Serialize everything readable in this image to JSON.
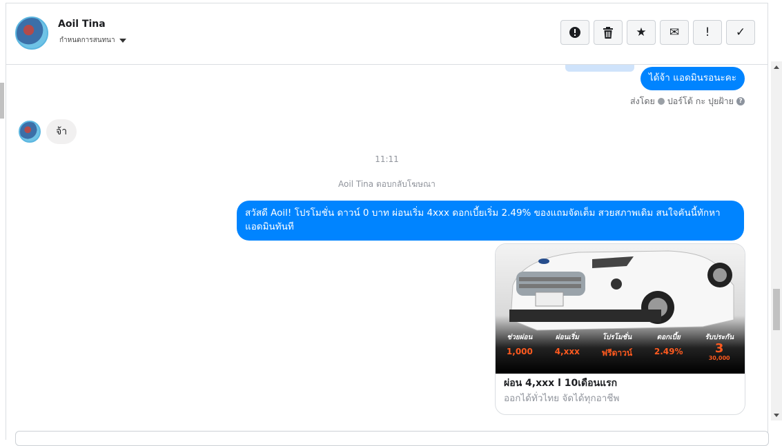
{
  "header": {
    "name": "Aoil Tina",
    "subtitle": "กำหนดการสนทนา"
  },
  "toolbar": {
    "buttons": [
      {
        "icon": "alert-circle-icon",
        "glyph": "!"
      },
      {
        "icon": "trash-icon"
      },
      {
        "icon": "star-icon",
        "glyph": "★"
      },
      {
        "icon": "envelope-icon",
        "glyph": "✉"
      },
      {
        "icon": "exclamation-icon",
        "glyph": "!"
      },
      {
        "icon": "check-icon",
        "glyph": "✓"
      }
    ]
  },
  "messages": {
    "top_reply": "ได้จ้า แอดมินรอนะคะ",
    "sent_by_label": "ส่งโดย",
    "sent_by_name": "ปอร์โต้ กะ ปุยฝ้าย",
    "incoming_text": "จ้า",
    "time": "11:11",
    "ad_reply_note": "Aoil Tina ตอบกลับโฆษณา",
    "promo_text": "สวัสดี Aoil! โปรโมชั่น ดาวน์ 0 บาท ผ่อนเริ่ม 4xxx ดอกเบี้ยเริ่ม 2.49% ของแถมจัดเต็ม สวยสภาพเดิม สนใจคันนี้ทักหาแอดมินทันที"
  },
  "card": {
    "title": "ผ่อน 4,xxx l 10เดือนแรก",
    "subtitle": "ออกได้ทั่วไทย จัดได้ทุกอาชีพ",
    "promo_items": [
      {
        "label": "ช่วยผ่อน",
        "value": "1,000"
      },
      {
        "label": "ผ่อนเริ่ม",
        "value": "4,xxx"
      },
      {
        "label": "โปรโมชั่น",
        "value": "ฟรีดาวน์"
      },
      {
        "label": "ดอกเบี้ย",
        "value": "2.49%"
      },
      {
        "label": "รับประกัน",
        "value": "3",
        "extra": "30,000"
      }
    ]
  },
  "colors": {
    "accent_blue": "#0084ff",
    "promo_orange": "#ff5a1f"
  }
}
